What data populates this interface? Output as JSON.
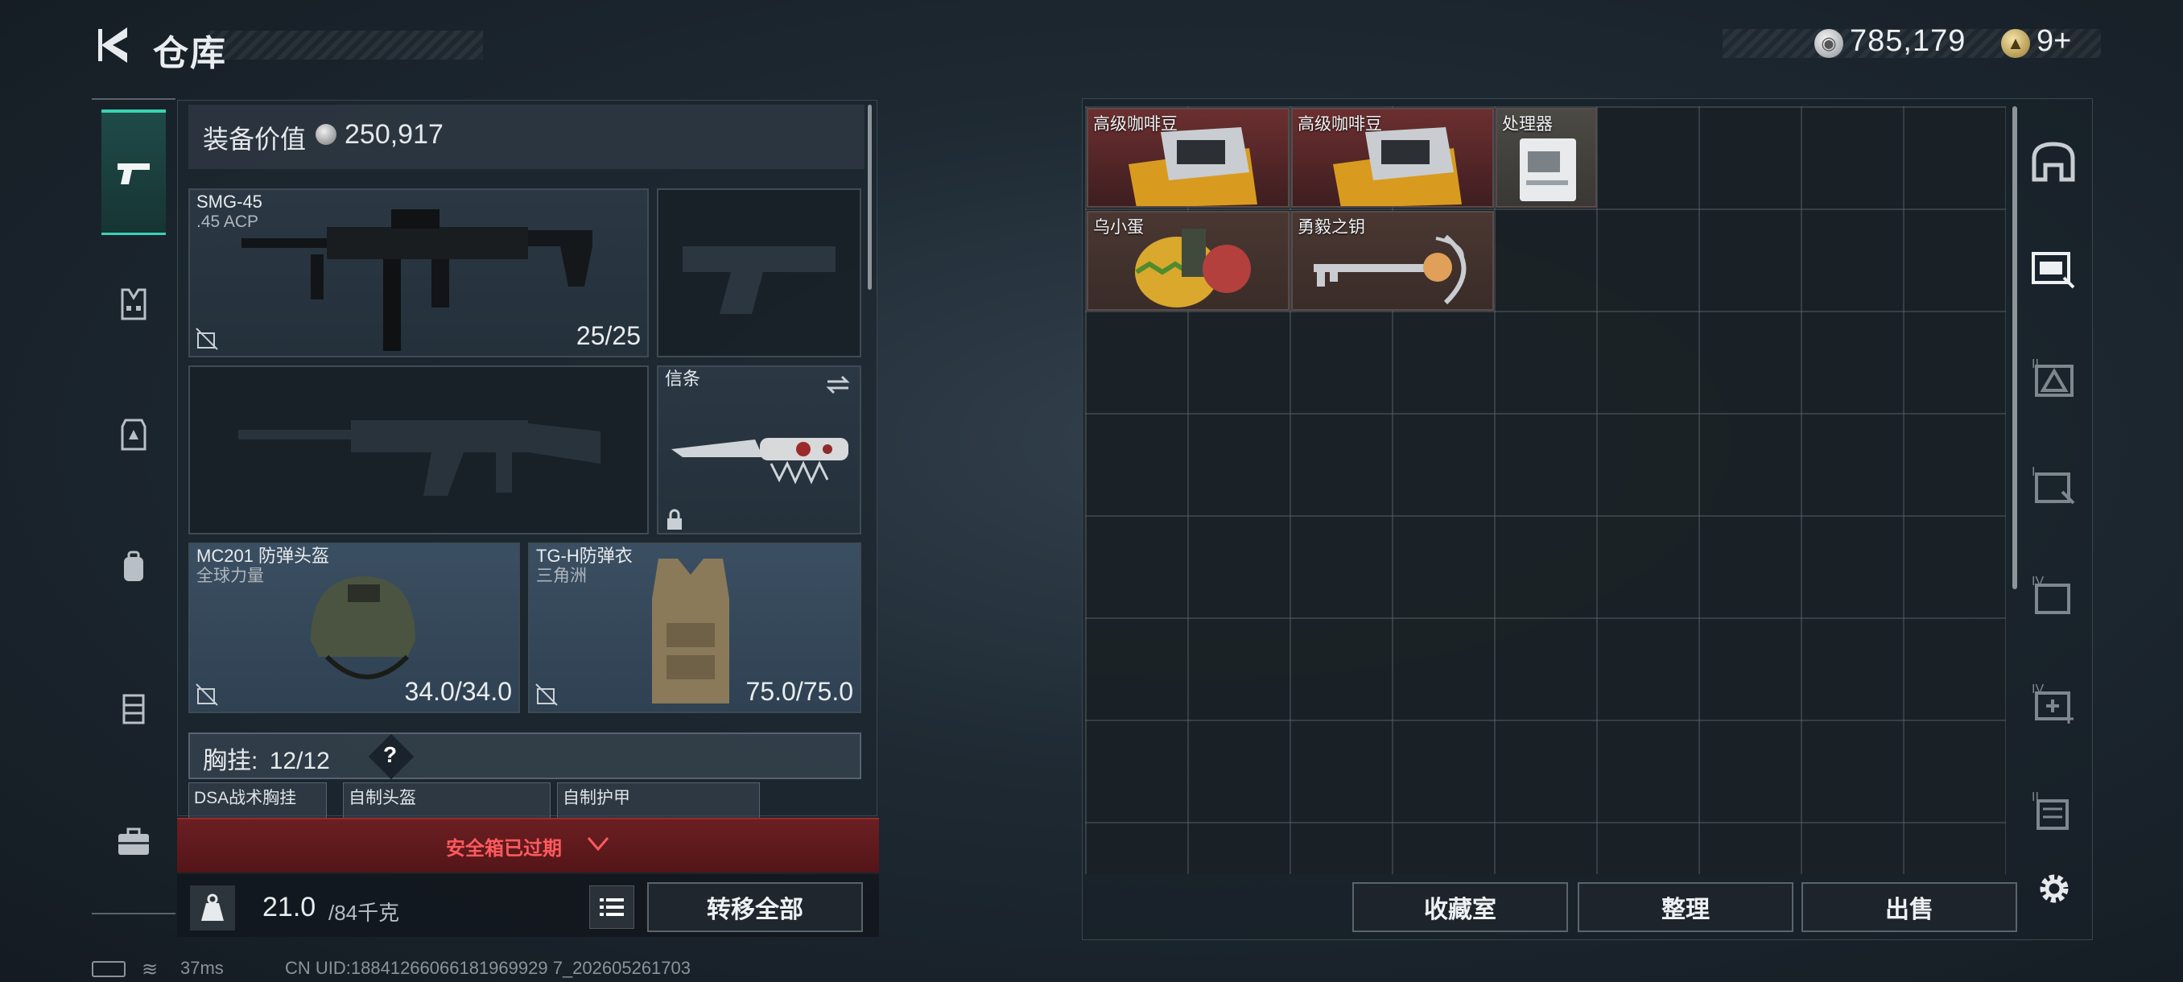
{
  "header": {
    "title": "仓库",
    "money": "785,179",
    "tickets": "9+"
  },
  "left_rail": [
    "weapons-icon",
    "vest-icon",
    "armor-icon",
    "backpack-icon",
    "chest-rig-icon",
    "briefcase-icon"
  ],
  "equipment": {
    "value_label": "装备价值",
    "value": "250,917",
    "primary": {
      "name": "SMG-45",
      "ammo": ".45 ACP",
      "count": "25/25"
    },
    "melee": {
      "name": "信条"
    },
    "helmet": {
      "name": "MC201 防弹头盔",
      "sub": "全球力量",
      "count": "34.0/34.0"
    },
    "armor": {
      "name": "TG-H防弹衣",
      "sub": "三角洲",
      "count": "75.0/75.0"
    },
    "chest": {
      "label": "胸挂:",
      "count": "12/12",
      "help": "?"
    },
    "mini": [
      {
        "name": "DSA战术胸挂"
      },
      {
        "name": "自制头盔"
      },
      {
        "name": "自制护甲"
      }
    ],
    "safebox_status": "安全箱已过期",
    "weight": "21.0",
    "weight_max": "/84千克",
    "transfer_all": "转移全部"
  },
  "storage": {
    "items": [
      {
        "name": "高级咖啡豆"
      },
      {
        "name": "高级咖啡豆"
      },
      {
        "name": "处理器"
      },
      {
        "name": "乌小蛋"
      },
      {
        "name": "勇毅之钥"
      }
    ],
    "buttons": {
      "collection": "收藏室",
      "sort": "整理",
      "sell": "出售"
    }
  },
  "status_bar": {
    "ping": "37ms",
    "uid": "CN UID:18841266066181969929 7_202605261703"
  }
}
